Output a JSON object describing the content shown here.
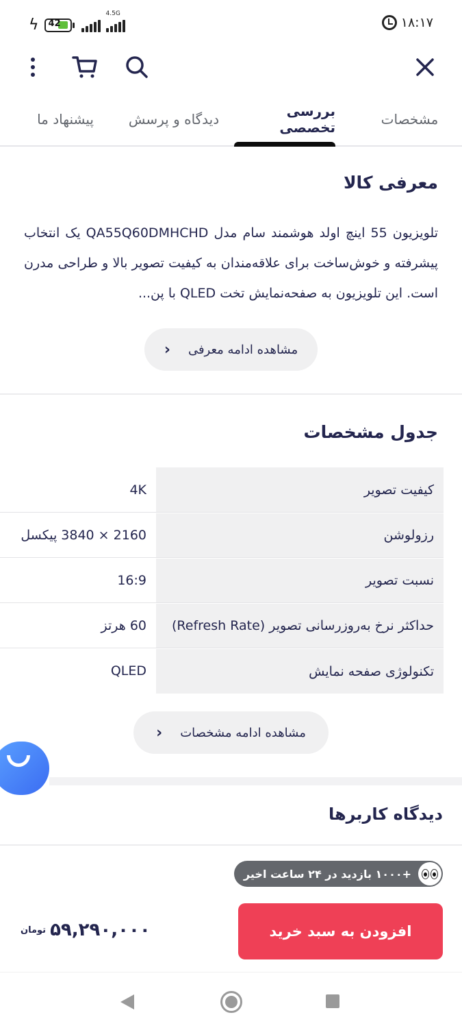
{
  "status_bar": {
    "time": "۱۸:۱۷",
    "battery": "42",
    "network": "4.5G",
    "icons": [
      "charging-icon",
      "battery-icon",
      "signal-icon",
      "alarm-icon"
    ]
  },
  "toolbar": {
    "icons": [
      "more-vertical-icon",
      "cart-icon",
      "search-icon",
      "close-icon"
    ]
  },
  "tabs": [
    {
      "label": "مشخصات",
      "active": false
    },
    {
      "label": "بررسی تخصصی",
      "active": true
    },
    {
      "label": "دیدگاه و پرسش",
      "active": false
    },
    {
      "label": "پیشنهاد ما",
      "active": false
    }
  ],
  "intro": {
    "title": "معرفی کالا",
    "text": "تلویزیون 55 اینچ اولد هوشمند سام مدل QA55Q60DMHCHD یک انتخاب پیشرفته و خوش‌ساخت برای علاقه‌مندان به کیفیت تصویر بالا و طراحی مدرن است. این تلویزیون به صفحه‌نمایش تخت QLED با پن...",
    "more_button": "مشاهده ادامه معرفی"
  },
  "specs": {
    "title": "جدول مشخصات",
    "rows": [
      {
        "key": "کیفیت تصویر",
        "value": "4K"
      },
      {
        "key": "رزولوشن",
        "value": "2160 × 3840 پیکسل"
      },
      {
        "key": "نسبت تصویر",
        "value": "16:9"
      },
      {
        "key": "حداکثر نرخ به‌روزرسانی تصویر (Refresh Rate)",
        "value": "60 هرتز"
      },
      {
        "key": "تکنولوژی صفحه نمایش",
        "value": "QLED"
      }
    ],
    "more_button": "مشاهده ادامه مشخصات"
  },
  "reviews": {
    "title": "دیدگاه کاربرها"
  },
  "purchase": {
    "visits": "+۱۰۰۰ بازدید در ۲۴ ساعت اخیر",
    "add_to_cart": "افزودن به سبد خرید",
    "price": "۵۹,۲۹۰,۰۰۰",
    "currency": "تومان"
  },
  "colors": {
    "primary": "#ef4056",
    "text": "#23254e",
    "chat_button": "#3b6cf2"
  }
}
